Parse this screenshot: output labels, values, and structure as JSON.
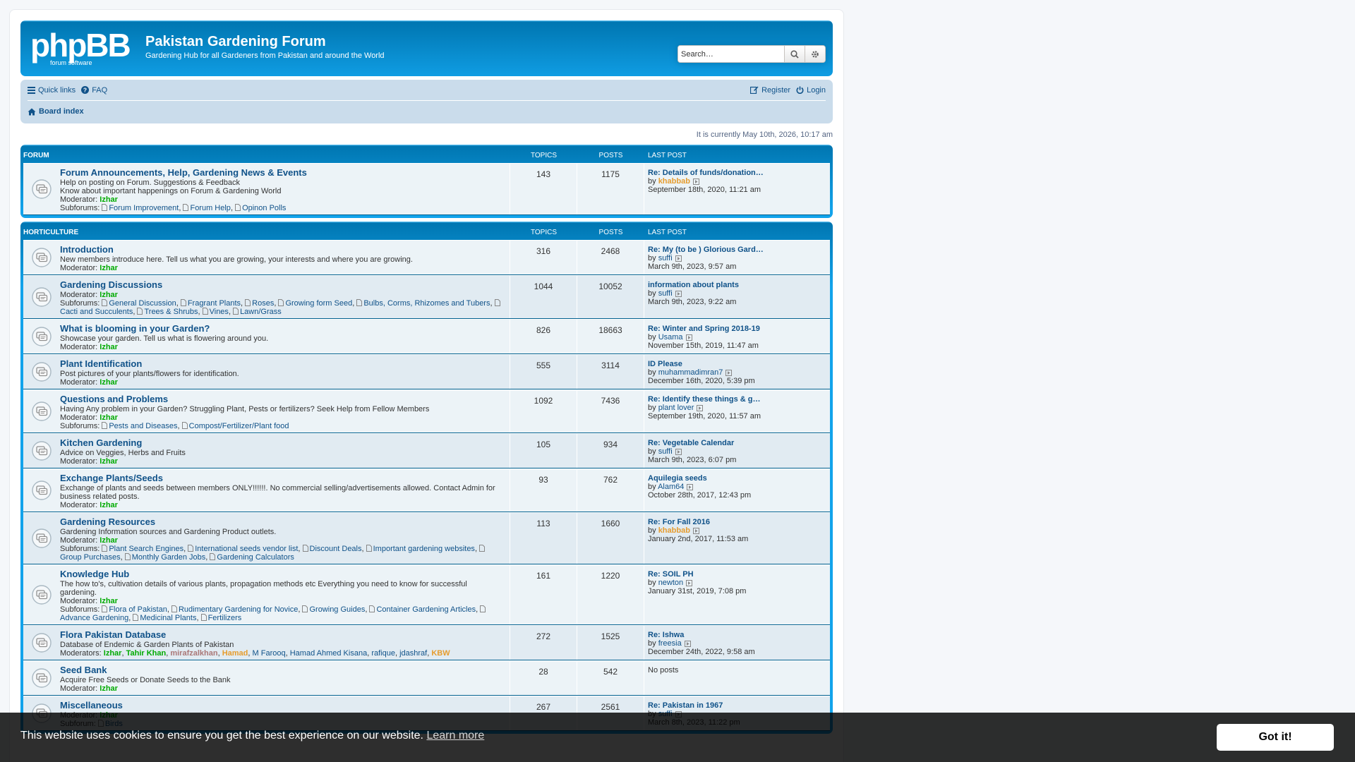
{
  "header": {
    "logo_text": "phpBB forum software",
    "site_title": "Pakistan Gardening Forum",
    "site_description": "Gardening Hub for all Gardeners from Pakistan and around the World",
    "search_placeholder": "Search…"
  },
  "nav": {
    "quick_links": "Quick links",
    "faq": "FAQ",
    "register": "Register",
    "login": "Login",
    "board_index": "Board index"
  },
  "current_time": "It is currently May 10th, 2026, 10:17 am",
  "columns": {
    "topics": "TOPICS",
    "posts": "POSTS",
    "last_post": "LAST POST"
  },
  "categories": [
    {
      "name": "FORUM",
      "forums": [
        {
          "title": "Forum Announcements, Help, Gardening News & Events",
          "desc": [
            "Help on posting on Forum. Suggestions & Feedback",
            "Know about important happenings on Forum & Gardening World"
          ],
          "mod_label": "Moderator:",
          "moderator": "Izhar",
          "subforums_label": "Subforums:",
          "subforums": [
            "Forum Improvement",
            "Forum Help",
            "Opinon Polls"
          ],
          "topics": "143",
          "posts": "1175",
          "last_title": "Re: Details of funds/donation…",
          "last_by": "by",
          "last_user": "khabbab",
          "last_user_color": "orange",
          "last_date": "September 18th, 2020, 11:21 am"
        }
      ]
    },
    {
      "name": "HORTICULTURE",
      "forums": [
        {
          "title": "Introduction",
          "desc": [
            "New members introduce here. Tell us what you are growing, your interests and where you are growing."
          ],
          "mod_label": "Moderator:",
          "moderator": "Izhar",
          "topics": "316",
          "posts": "2468",
          "last_title": "Re: My (to be ) Glorious Gard…",
          "last_by": "by",
          "last_user": "suffi",
          "last_date": "March 9th, 2023, 9:57 am"
        },
        {
          "title": "Gardening Discussions",
          "desc": [],
          "mod_label": "Moderator:",
          "moderator": "Izhar",
          "subforums_label": "Subforums:",
          "subforums": [
            "General Discussion",
            "Fragrant Plants",
            "Roses",
            "Growing form Seed",
            "Bulbs, Corms, Rhizomes and Tubers",
            "Cacti and Succulents",
            "Trees & Shrubs",
            "Vines",
            "Lawn/Grass"
          ],
          "topics": "1044",
          "posts": "10052",
          "last_title": "information about plants",
          "last_by": "by",
          "last_user": "suffi",
          "last_date": "March 9th, 2023, 9:22 am"
        },
        {
          "title": "What is blooming in your Garden?",
          "desc": [
            "Showcase your garden. Tell us what is flowering around you."
          ],
          "mod_label": "Moderator:",
          "moderator": "Izhar",
          "topics": "826",
          "posts": "18663",
          "last_title": "Re: Winter and Spring 2018-19",
          "last_by": "by",
          "last_user": "Usama",
          "last_date": "November 15th, 2019, 11:47 am"
        },
        {
          "title": "Plant Identification",
          "desc": [
            "Post pictures of your plants/flowers for identification."
          ],
          "mod_label": "Moderator:",
          "moderator": "Izhar",
          "topics": "555",
          "posts": "3114",
          "last_title": "ID Please",
          "last_by": "by",
          "last_user": "muhammadimran7",
          "last_date": "December 16th, 2020, 5:39 pm"
        },
        {
          "title": "Questions and Problems",
          "desc": [
            "Having Any problem in your Garden? Struggling Plant, Pests or fertilizers? Seek Help from Fellow Members"
          ],
          "mod_label": "Moderator:",
          "moderator": "Izhar",
          "subforums_label": "Subforums:",
          "subforums": [
            "Pests and Diseases",
            "Compost/Fertilizer/Plant food"
          ],
          "topics": "1092",
          "posts": "7436",
          "last_title": "Re: Identify these things & g…",
          "last_by": "by",
          "last_user": "plant lover",
          "last_date": "September 19th, 2020, 11:57 am"
        },
        {
          "title": "Kitchen Gardening",
          "desc": [
            "Advice on Veggies, Herbs and Fruits"
          ],
          "mod_label": "Moderator:",
          "moderator": "Izhar",
          "topics": "105",
          "posts": "934",
          "last_title": "Re: Vegetable Calendar",
          "last_by": "by",
          "last_user": "suffi",
          "last_date": "March 9th, 2023, 6:07 pm"
        },
        {
          "title": "Exchange Plants/Seeds",
          "desc": [
            "Exchange of plants and seeds between members ONLY!!!!!!. No commercial selling/advertisements allowed. Contact Admin for business related posts."
          ],
          "mod_label": "Moderator:",
          "moderator": "Izhar",
          "topics": "93",
          "posts": "762",
          "last_title": "Aquilegia seeds",
          "last_by": "by",
          "last_user": "Alam64",
          "last_date": "October 28th, 2017, 12:43 pm"
        },
        {
          "title": "Gardening Resources",
          "desc": [
            "Gardening Information sources and Gardening Product outlets."
          ],
          "mod_label": "Moderator:",
          "moderator": "Izhar",
          "subforums_label": "Subforums:",
          "subforums": [
            "Plant Search Engines",
            "International seeds vendor list",
            "Discount Deals",
            "Important gardening websites",
            "Group Purchases",
            "Monthly Garden Jobs",
            "Gardening Calculators"
          ],
          "topics": "113",
          "posts": "1660",
          "last_title": "Re: For Fall 2016",
          "last_by": "by",
          "last_user": "khabbab",
          "last_user_color": "orange",
          "last_date": "January 2nd, 2017, 11:53 am"
        },
        {
          "title": "Knowledge Hub",
          "desc": [
            "The how to's, cultivation details of various plants, propagation methods etc Everything you need to know for successful gardening."
          ],
          "mod_label": "Moderator:",
          "moderator": "Izhar",
          "subforums_label": "Subforums:",
          "subforums": [
            "Flora of Pakistan",
            "Rudimentary Gardening for Novice",
            "Growing Guides",
            "Container Gardening Articles",
            "Advance Gardening",
            "Medicinal Plants",
            "Fertilizers"
          ],
          "topics": "161",
          "posts": "1220",
          "last_title": "Re: SOIL PH",
          "last_by": "by",
          "last_user": "newton",
          "last_date": "January 31st, 2019, 7:08 pm"
        },
        {
          "title": "Flora Pakistan Database",
          "desc": [
            "Database of Endemic & Garden Plants of Pakistan"
          ],
          "mod_label": "Moderators:",
          "moderators": [
            {
              "name": "Izhar",
              "color": "green"
            },
            {
              "name": "Tahir Khan",
              "color": "green"
            },
            {
              "name": "mirafzalkhan",
              "color": "pink"
            },
            {
              "name": "Hamad",
              "color": "orange"
            },
            {
              "name": "M Farooq",
              "color": "blue"
            },
            {
              "name": "Hamad Ahmed Kisana",
              "color": "blue"
            },
            {
              "name": "rafique",
              "color": "blue"
            },
            {
              "name": "jdashraf",
              "color": "blue"
            },
            {
              "name": "KBW",
              "color": "orange"
            }
          ],
          "topics": "272",
          "posts": "1525",
          "last_title": "Re: Ishwa",
          "last_by": "by",
          "last_user": "freesia",
          "last_date": "December 24th, 2022, 9:58 am"
        },
        {
          "title": "Seed Bank",
          "desc": [
            "Acquire Free Seeds or Donate Seeds to the Bank"
          ],
          "mod_label": "Moderator:",
          "moderator": "Izhar",
          "topics": "28",
          "posts": "542",
          "no_posts": "No posts"
        },
        {
          "title": "Miscellaneous",
          "desc": [],
          "mod_label": "Moderator:",
          "moderator": "Izhar",
          "subforums_label": "Subforum:",
          "subforums": [
            "Birds"
          ],
          "topics": "267",
          "posts": "2561",
          "last_title": "Re: Pakistan in 1967",
          "last_by": "by",
          "last_user": "suffi",
          "last_date": "March 8th, 2023, 11:22 pm"
        }
      ]
    }
  ],
  "cookie": {
    "message": "This website uses cookies to ensure you get the best experience on our website.",
    "learn_more": "Learn more",
    "button": "Got it!"
  },
  "colors": {
    "accent": "#12a3eb",
    "link": "#105289",
    "moderator": "#00aa00",
    "orange_user": "#e69c2e"
  }
}
